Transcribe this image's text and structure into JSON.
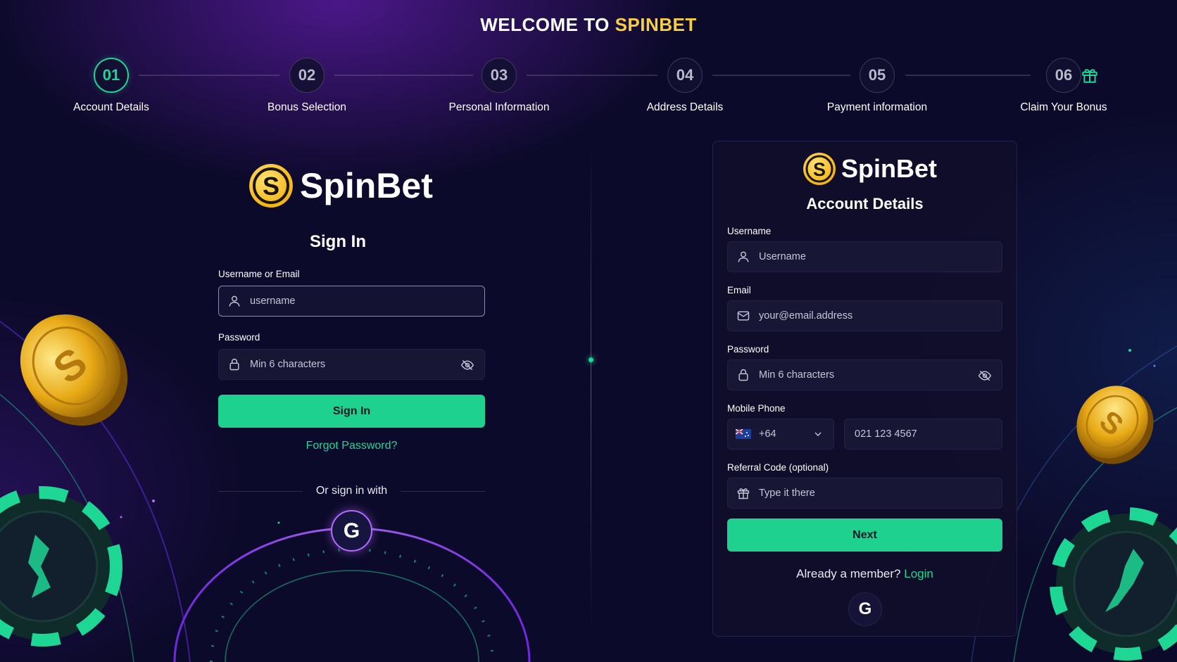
{
  "header": {
    "welcome_prefix": "WELCOME TO ",
    "welcome_brand": "SPINBET"
  },
  "steps": [
    {
      "num": "01",
      "label": "Account Details",
      "active": true
    },
    {
      "num": "02",
      "label": "Bonus Selection"
    },
    {
      "num": "03",
      "label": "Personal Information"
    },
    {
      "num": "04",
      "label": "Address Details"
    },
    {
      "num": "05",
      "label": "Payment information"
    },
    {
      "num": "06",
      "label": "Claim Your Bonus"
    }
  ],
  "signin": {
    "logo_text": "SpinBet",
    "title": "Sign In",
    "username_label": "Username or Email",
    "username_value": "username",
    "password_label": "Password",
    "password_placeholder": "Min 6 characters",
    "submit_label": "Sign In",
    "forgot_label": "Forgot Password?",
    "or_label": "Or sign in with",
    "google_label": "G"
  },
  "signup": {
    "logo_text": "SpinBet",
    "title": "Account Details",
    "username_label": "Username",
    "username_placeholder": "Username",
    "email_label": "Email",
    "email_placeholder": "your@email.address",
    "password_label": "Password",
    "password_placeholder": "Min 6 characters",
    "phone_label": "Mobile Phone",
    "country_code": "+64",
    "phone_placeholder": "021 123 4567",
    "referral_label": "Referral Code (optional)",
    "referral_placeholder": "Type it there",
    "next_label": "Next",
    "member_text": "Already a member? ",
    "login_label": "Login",
    "google_label": "G"
  },
  "colors": {
    "accent": "#1fd795",
    "brand_gold": "#f7cf3e",
    "background": "#0c0a2a"
  },
  "icons": [
    "user-icon",
    "lock-icon",
    "eye-off-icon",
    "mail-icon",
    "gift-icon",
    "flag-icon",
    "chevron-down-icon",
    "google-icon",
    "coin-icon",
    "poker-chip-icon"
  ]
}
